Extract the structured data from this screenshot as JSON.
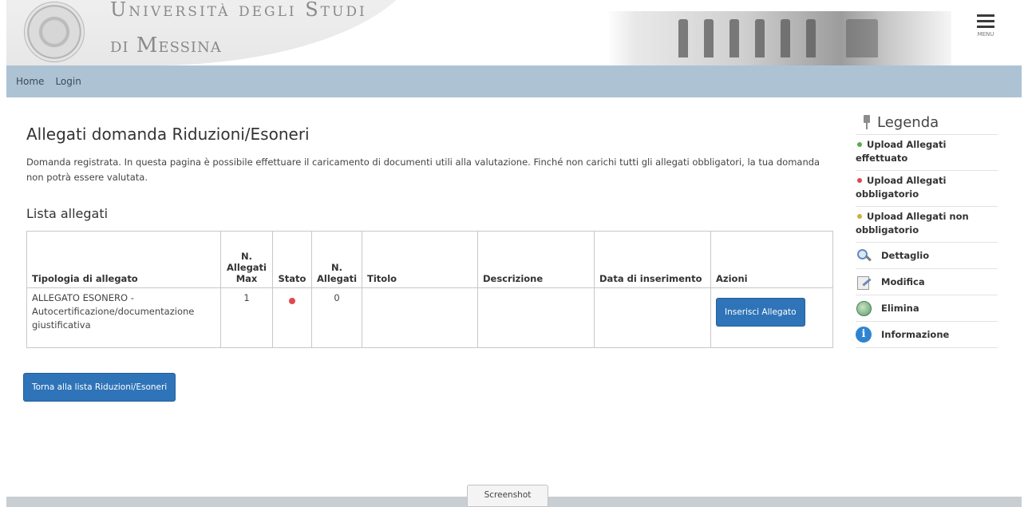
{
  "header": {
    "university_line1": "Università degli Studi",
    "university_line2": "di Messina",
    "menu_label": "MENU"
  },
  "nav": {
    "items": [
      "Home",
      "Login"
    ]
  },
  "main": {
    "title": "Allegati domanda Riduzioni/Esoneri",
    "intro": "Domanda registrata. In questa pagina è possibile effettuare il caricamento di documenti utili alla valutazione. Finché non carichi tutti gli allegati obbligatori, la tua domanda non potrà essere valutata.",
    "list_title": "Lista allegati",
    "table": {
      "headers": [
        "Tipologia di allegato",
        "N. Allegati Max",
        "Stato",
        "N. Allegati",
        "Titolo",
        "Descrizione",
        "Data di inserimento",
        "Azioni"
      ],
      "rows": [
        {
          "tipologia": "ALLEGATO ESONERO - Autocertificazione/documentazione giustificativa",
          "max": "1",
          "stato": "obbligatorio",
          "n_allegati": "0",
          "titolo": "",
          "descrizione": "",
          "data": "",
          "azione": "Inserisci Allegato"
        }
      ]
    },
    "back_button": "Torna alla lista Riduzioni/Esoneri"
  },
  "legend": {
    "title": "Legenda",
    "status_items": [
      {
        "label": "Upload Allegati effettuato",
        "color": "#58ad4a"
      },
      {
        "label": "Upload Allegati obbligatorio",
        "color": "#e2474b"
      },
      {
        "label": "Upload Allegati non obbligatorio",
        "color": "#c9b23a"
      }
    ],
    "actions": [
      {
        "label": "Dettaglio",
        "icon": "magnifier-icon"
      },
      {
        "label": "Modifica",
        "icon": "edit-icon"
      },
      {
        "label": "Elimina",
        "icon": "globe-icon"
      },
      {
        "label": "Informazione",
        "icon": "info-icon"
      }
    ]
  },
  "footer": {
    "screenshot_tab": "Screenshot"
  },
  "colors": {
    "navbar": "#adc3d4",
    "primary_button": "#2f74b8",
    "status_red": "#e2474b"
  }
}
